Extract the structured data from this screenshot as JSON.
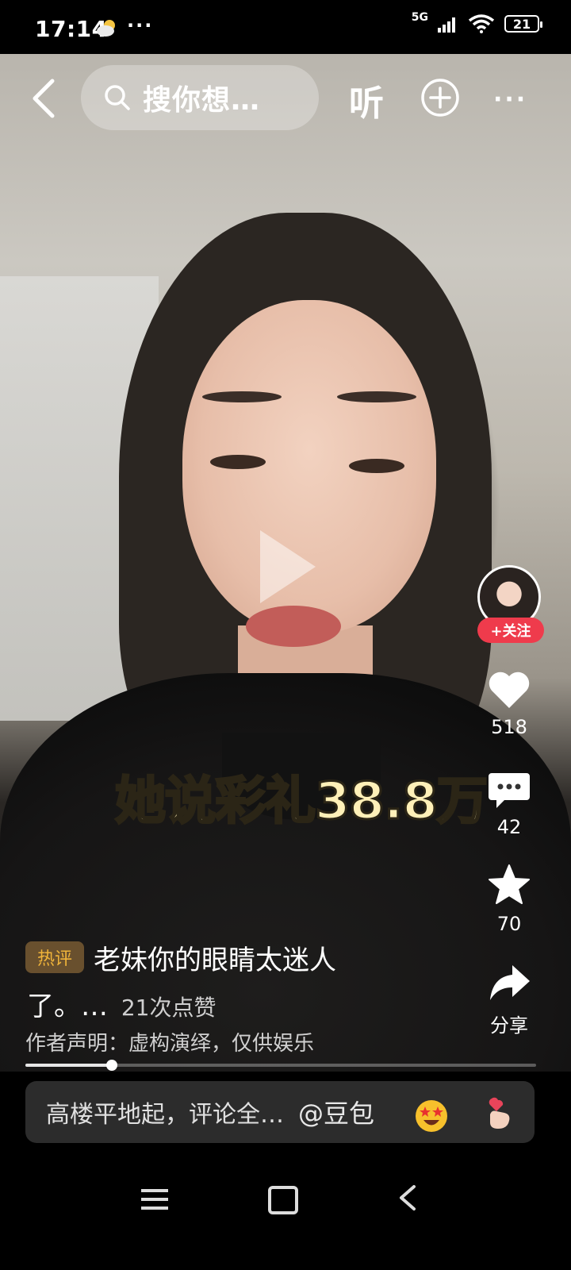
{
  "status_bar": {
    "time": "17:14",
    "weather_icon": "cloud-sun-icon",
    "more_dots": "···",
    "network": "5G",
    "battery": "21"
  },
  "top_bar": {
    "search_placeholder": "搜你想…",
    "listen_label": "听"
  },
  "video": {
    "caption": "她说彩礼38.8万"
  },
  "right_rail": {
    "follow_label": "+关注",
    "like_count": "518",
    "comment_count": "42",
    "favorite_count": "70",
    "share_label": "分享"
  },
  "hot_comment": {
    "tag": "热评",
    "text_line1": "老妹你的眼睛太迷人",
    "text_line2": "了。…",
    "likes": "21次点赞"
  },
  "disclaimer": "作者声明：虚构演绎，仅供娱乐",
  "progress": {
    "fraction": 0.17
  },
  "comment_bar": {
    "placeholder": "高楼平地起，评论全…",
    "mention": "@豆包"
  },
  "colors": {
    "follow_red": "#ef3b4c",
    "hot_tag_gold": "#f0b43a",
    "caption_yellow": "#fff0b8"
  }
}
